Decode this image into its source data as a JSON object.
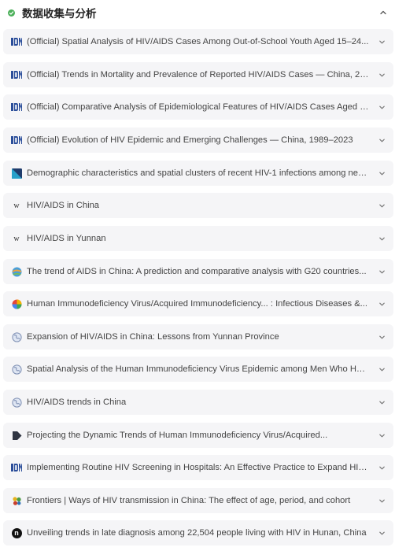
{
  "header": {
    "title": "数据收集与分析"
  },
  "items": [
    {
      "title": "(Official) Spatial Analysis of HIV/AIDS Cases Among Out-of-School Youth Aged 15–24...",
      "icon": "cn-official-icon"
    },
    {
      "title": "(Official) Trends in Mortality and Prevalence of Reported HIV/AIDS Cases — China, 200...",
      "icon": "cn-official-icon"
    },
    {
      "title": "(Official) Comparative Analysis of Epidemiological Features of HIV/AIDS Cases Aged Ov...",
      "icon": "cn-official-icon"
    },
    {
      "title": "(Official) Evolution of HIV Epidemic and Emerging Challenges — China, 1989–2023",
      "icon": "cn-official-icon"
    },
    {
      "title": "Demographic characteristics and spatial clusters of recent HIV-1 infections among newly...",
      "icon": "journal-icon"
    },
    {
      "title": "HIV/AIDS in China",
      "icon": "wikipedia-icon"
    },
    {
      "title": "HIV/AIDS in Yunnan",
      "icon": "wikipedia-icon"
    },
    {
      "title": "The trend of AIDS in China: A prediction and comparative analysis with G20 countries...",
      "icon": "colorful-globe-icon"
    },
    {
      "title": "Human Immunodeficiency Virus/Acquired Immunodeficiency... : Infectious Diseases &...",
      "icon": "colorful-cube-icon"
    },
    {
      "title": "Expansion of HIV/AIDS in China: Lessons from Yunnan Province",
      "icon": "globe-icon"
    },
    {
      "title": "Spatial Analysis of the Human Immunodeficiency Virus Epidemic among Men Who Have...",
      "icon": "globe-icon"
    },
    {
      "title": "HIV/AIDS trends in China",
      "icon": "globe-icon"
    },
    {
      "title": "Projecting the Dynamic Trends of Human Immunodeficiency Virus/Acquired...",
      "icon": "dark-arrow-icon"
    },
    {
      "title": "Implementing Routine HIV Screening in Hospitals: An Effective Practice to Expand HIV...",
      "icon": "cn-official-icon"
    },
    {
      "title": "Frontiers | Ways of HIV transmission in China: The effect of age, period, and cohort",
      "icon": "frontiers-icon"
    },
    {
      "title": "Unveiling trends in late diagnosis among 22,504 people living with HIV in Hunan, China",
      "icon": "n-icon"
    }
  ],
  "colors": {
    "accent_check": "#4cb05a",
    "item_bg": "#f5f5f7",
    "official_blue": "#2b4e9a"
  }
}
